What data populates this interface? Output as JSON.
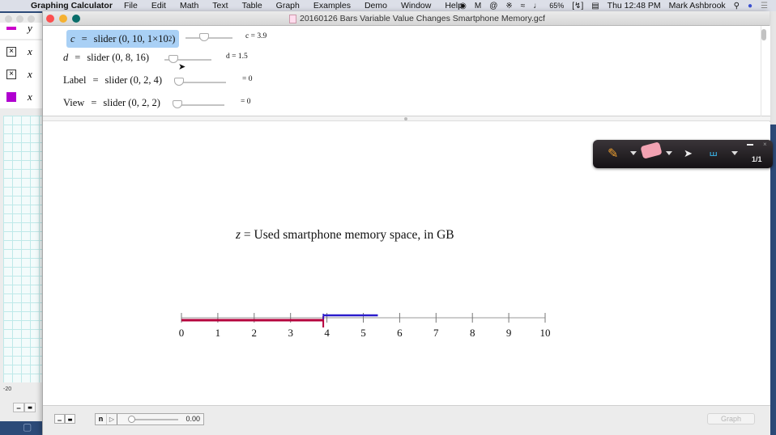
{
  "menubar": {
    "app_name": "Graphing Calculator",
    "items": [
      "File",
      "Edit",
      "Math",
      "Text",
      "Table",
      "Graph",
      "Examples",
      "Demo",
      "Window",
      "Help"
    ],
    "battery": "65%",
    "clock": "Thu 12:48 PM",
    "user": "Mark Ashbrook"
  },
  "back_window": {
    "equations": [
      {
        "var": "y",
        "swatch": "magenta-line"
      },
      {
        "var": "x",
        "swatch": "unchecked-box"
      },
      {
        "var": "x",
        "swatch": "unchecked-box"
      },
      {
        "var": "x",
        "swatch": "purple-square"
      }
    ],
    "axis_label": "-20"
  },
  "window": {
    "title": "20160126 Bars Variable Value Changes Smartphone Memory.gcf"
  },
  "equations": [
    {
      "lhs": "c",
      "rhs": "slider (0, 10, 1×10",
      "exp": "2",
      "rhs_end": ")",
      "value_label": "c = 3.9",
      "value": 3.9,
      "min": 0,
      "max": 10,
      "selected": true
    },
    {
      "lhs": "d",
      "rhs": "slider (0, 8, 16)",
      "value_label": "d = 1.5",
      "value": 1.5,
      "min": 0,
      "max": 8,
      "selected": false
    },
    {
      "lhs": "Label",
      "rhs": "slider (0, 2, 4)",
      "value_label": "= 0",
      "value": 0,
      "min": 0,
      "max": 2,
      "selected": false
    },
    {
      "lhs": "View",
      "rhs": "slider (0, 2, 2)",
      "value_label": "= 0",
      "value": 0,
      "min": 0,
      "max": 2,
      "selected": false
    }
  ],
  "graph": {
    "title_var": "z",
    "title_text": " = Used smartphone memory space, in GB",
    "axis_min": 0,
    "axis_max": 10,
    "ticks": [
      "0",
      "1",
      "2",
      "3",
      "4",
      "5",
      "6",
      "7",
      "8",
      "9",
      "10"
    ],
    "bars": [
      {
        "name": "used-c",
        "from": 0,
        "to": 3.9,
        "color": "#b5003c"
      },
      {
        "name": "change-d",
        "from": 3.9,
        "to": 5.4,
        "color": "#2a1ccc"
      }
    ]
  },
  "float_toolbar": {
    "page": "1/1"
  },
  "bottombar": {
    "anim_n": "n",
    "anim_value": "0.00",
    "anim_fraction": 0,
    "graph_button": "Graph"
  }
}
